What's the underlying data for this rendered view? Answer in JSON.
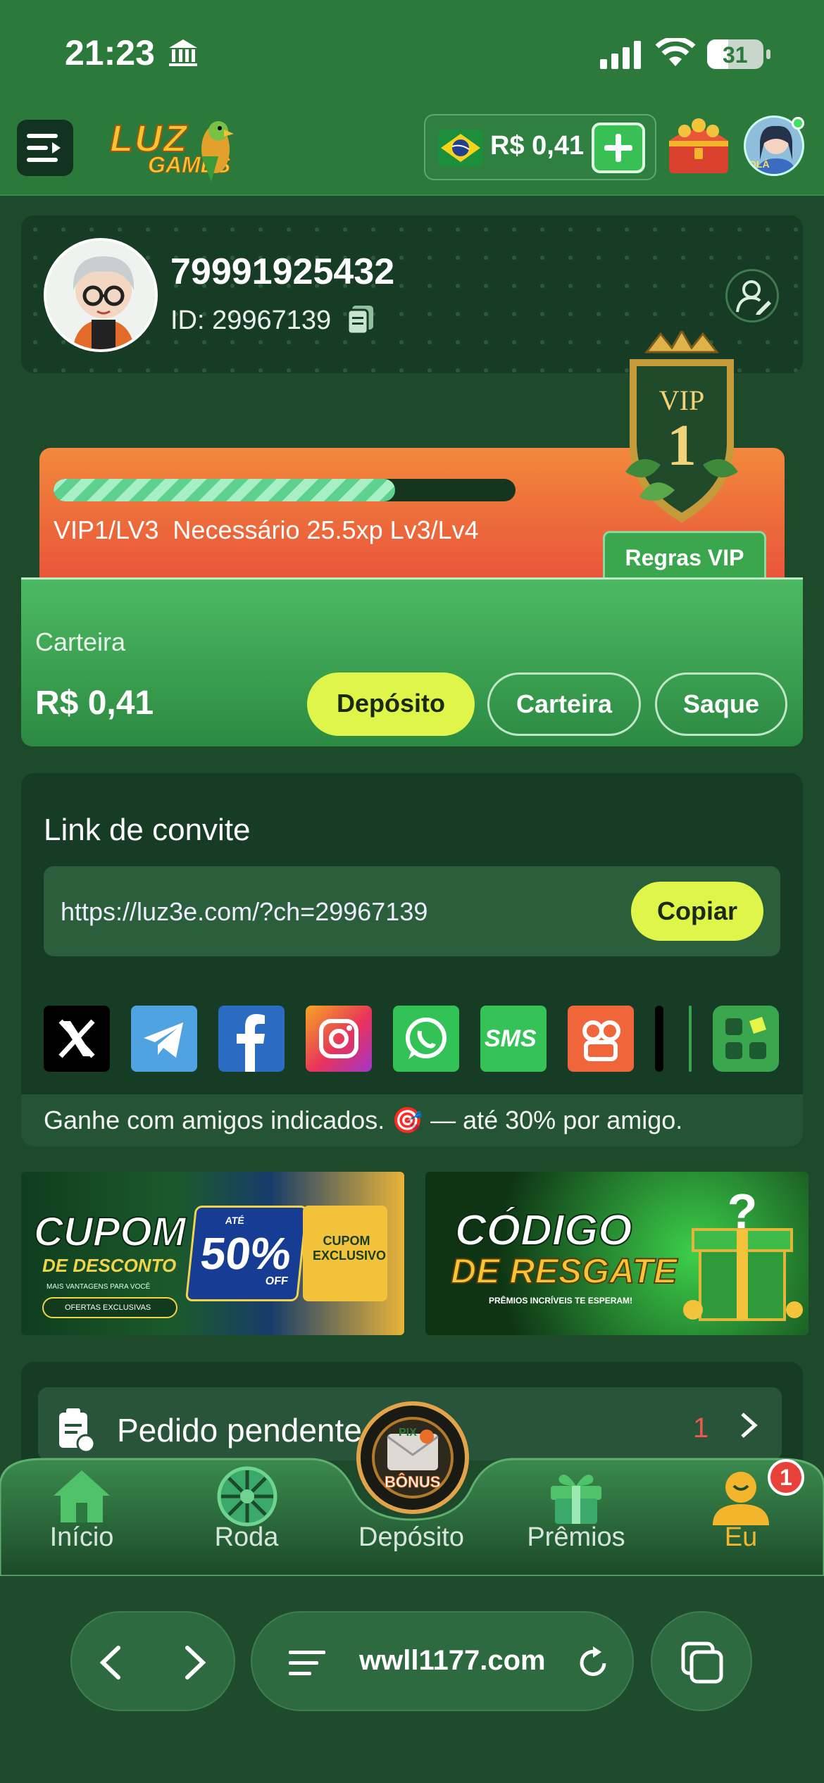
{
  "status_bar": {
    "time": "21:23",
    "battery": "31"
  },
  "header": {
    "logo_text_line1": "LUZ",
    "logo_text_line2": "GAMES",
    "balance": "R$ 0,41",
    "avatar_caption": "OLÁ"
  },
  "profile": {
    "phone": "79991925432",
    "user_id": "ID: 29967139"
  },
  "vip": {
    "progress": 0.74,
    "status_text": "VIP1/LV3  Necessário 25.5xp Lv3/Lv4",
    "rules_label": "Regras VIP",
    "badge_label": "VIP",
    "badge_level": "1"
  },
  "wallet": {
    "label": "Carteira",
    "amount": "R$ 0,41",
    "deposit_label": "Depósito",
    "wallet_label": "Carteira",
    "withdraw_label": "Saque"
  },
  "invite": {
    "title": "Link de convite",
    "url": "https://luz3e.com/?ch=29967139",
    "copy_label": "Copiar",
    "share_sms_label": "SMS",
    "footer": "Ganhe com amigos indicados. 🎯 — até 30% por amigo."
  },
  "banners": {
    "coupon": {
      "title": "CUPOM",
      "subtitle": "DE DESCONTO",
      "ate": "ATÉ",
      "percent": "50%",
      "off": "OFF",
      "tag": "CUPOM EXCLUSIVO",
      "small": "MAIS VANTAGENS PARA VOCÊ",
      "pill": "OFERTAS EXCLUSIVAS"
    },
    "redeem": {
      "title": "CÓDIGO",
      "subtitle": "DE RESGATE",
      "small": "PRÊMIOS INCRÍVEIS TE ESPERAM!"
    }
  },
  "pending": {
    "label": "Pedido pendente",
    "count": "1"
  },
  "bottom_nav": {
    "home": "Início",
    "wheel": "Roda",
    "deposit": "Depósito",
    "prizes": "Prêmios",
    "me": "Eu",
    "badge": "1",
    "pix_label": "PIX",
    "pix_bonus": "BÔNUS"
  },
  "browser": {
    "url": "wwll1177.com"
  },
  "colors": {
    "accent": "#dff54a",
    "primary_green": "#2b7a3c",
    "dark_card": "#173c25",
    "vip_orange": "#ee6f3b",
    "active_nav": "#f3b52b"
  }
}
